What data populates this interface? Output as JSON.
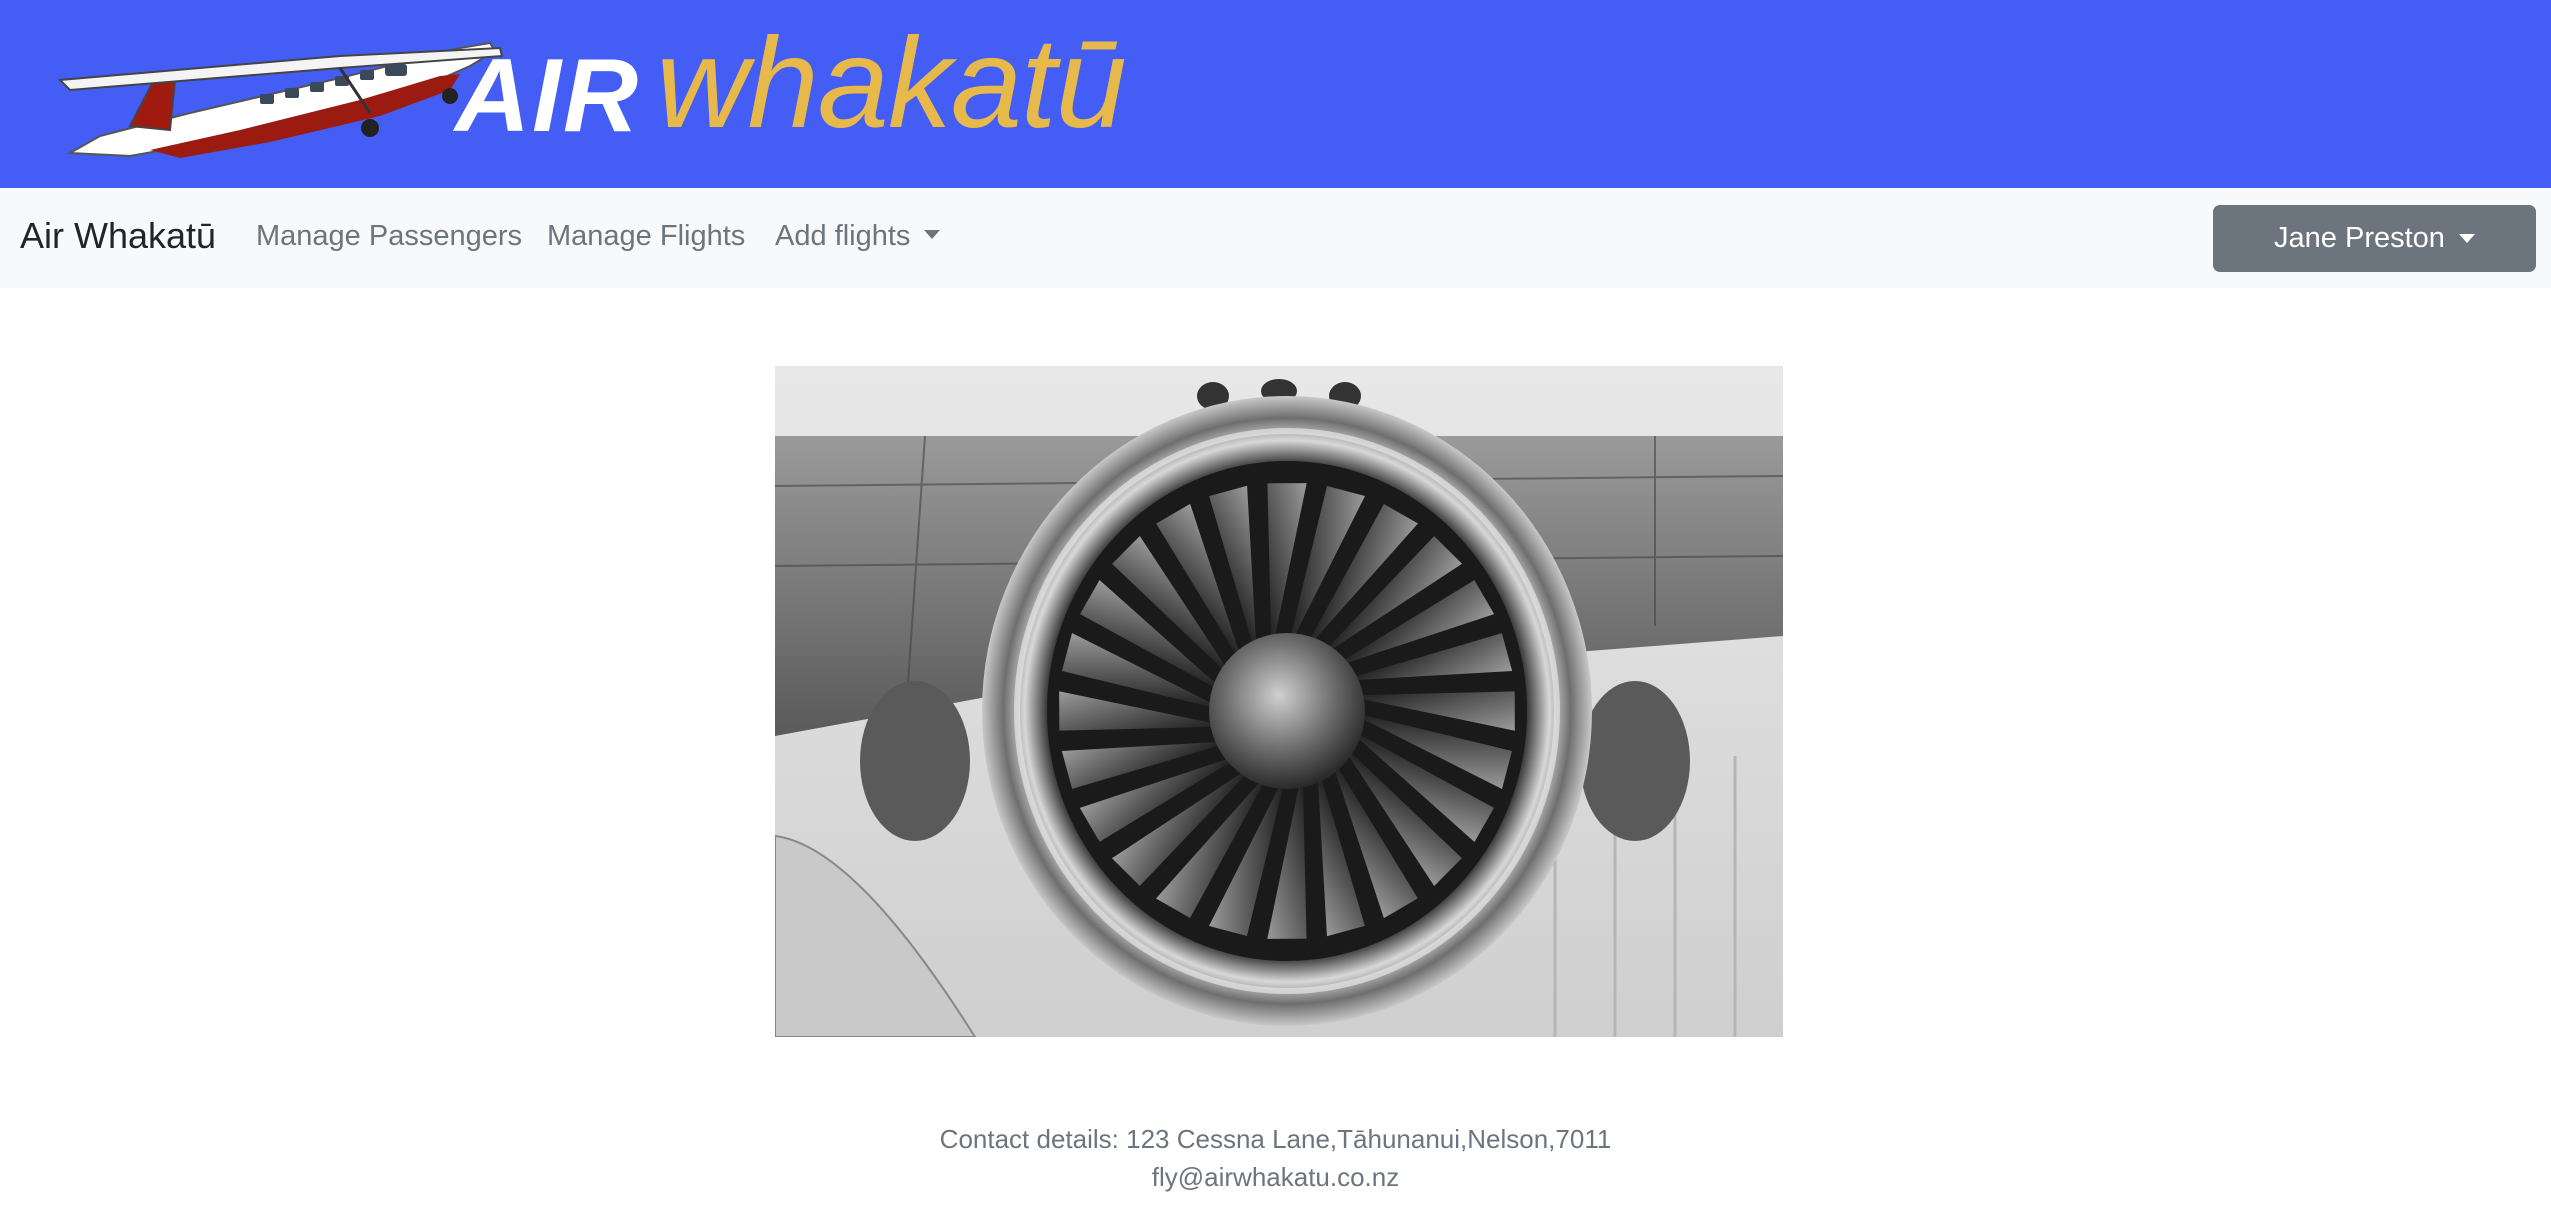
{
  "banner": {
    "logo_air": "AIR",
    "logo_whakatu": "whakatū"
  },
  "navbar": {
    "brand": "Air Whakatū",
    "links": [
      {
        "label": "Manage Passengers"
      },
      {
        "label": "Manage Flights"
      },
      {
        "label": "Add flights",
        "dropdown": true
      }
    ],
    "user": {
      "name": "Jane Preston",
      "dropdown": true
    }
  },
  "footer": {
    "contact": "Contact details: 123 Cessna Lane,Tāhunanui,Nelson,7011",
    "email": "fly@airwhakatu.co.nz"
  },
  "colors": {
    "banner": "#435df5",
    "logo_air": "#ffffff",
    "logo_whakatu": "#e6b94a",
    "navbar_bg": "#f8f9fa",
    "nav_link": "#6c757d",
    "user_button": "#6c757d"
  }
}
